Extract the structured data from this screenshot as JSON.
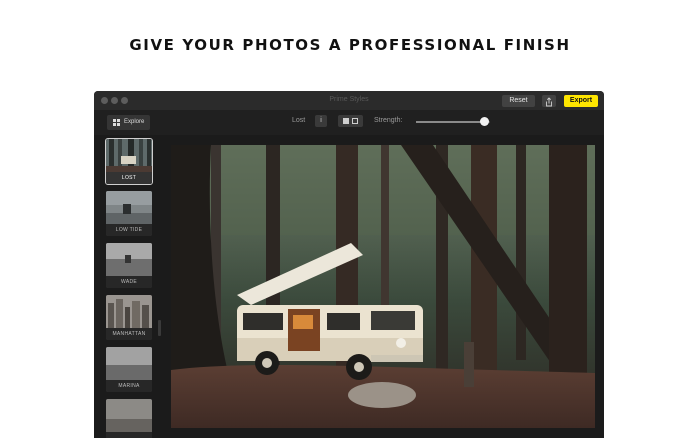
{
  "headline": "GIVE YOUR PHOTOS A PROFESSIONAL FINISH",
  "window": {
    "title": "Prime Styles",
    "reset_label": "Reset",
    "export_label": "Export",
    "share_icon": "share-icon"
  },
  "toolbar": {
    "explore_label": "Explore",
    "style_name": "Lost",
    "info_label": "i",
    "strength_label": "Strength:",
    "strength_value": 0.92
  },
  "styles": [
    {
      "label": "LOST",
      "active": true
    },
    {
      "label": "LOW TIDE",
      "active": false
    },
    {
      "label": "WADE",
      "active": false
    },
    {
      "label": "MANHATTAN",
      "active": false
    },
    {
      "label": "MARINA",
      "active": false
    },
    {
      "label": "",
      "active": false
    }
  ],
  "colors": {
    "export_accent": "#ffe600",
    "window_bg": "#1b1b1b",
    "titlebar_bg": "#2b2b2b"
  }
}
